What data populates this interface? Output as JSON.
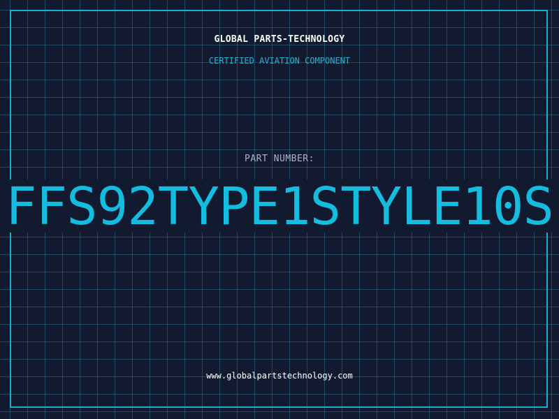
{
  "header": {
    "company_name": "GLOBAL PARTS-TECHNOLOGY",
    "subtitle": "CERTIFIED AVIATION COMPONENT"
  },
  "part": {
    "label": "PART NUMBER:",
    "number": "FFS92TYPE1STYLE10S"
  },
  "footer": {
    "url": "www.globalpartstechnology.com"
  },
  "colors": {
    "background": "#111a2f",
    "grid": "#2a6e8c",
    "accent": "#17b0d2",
    "text": "#ffffff",
    "label": "#a9b3c6"
  }
}
